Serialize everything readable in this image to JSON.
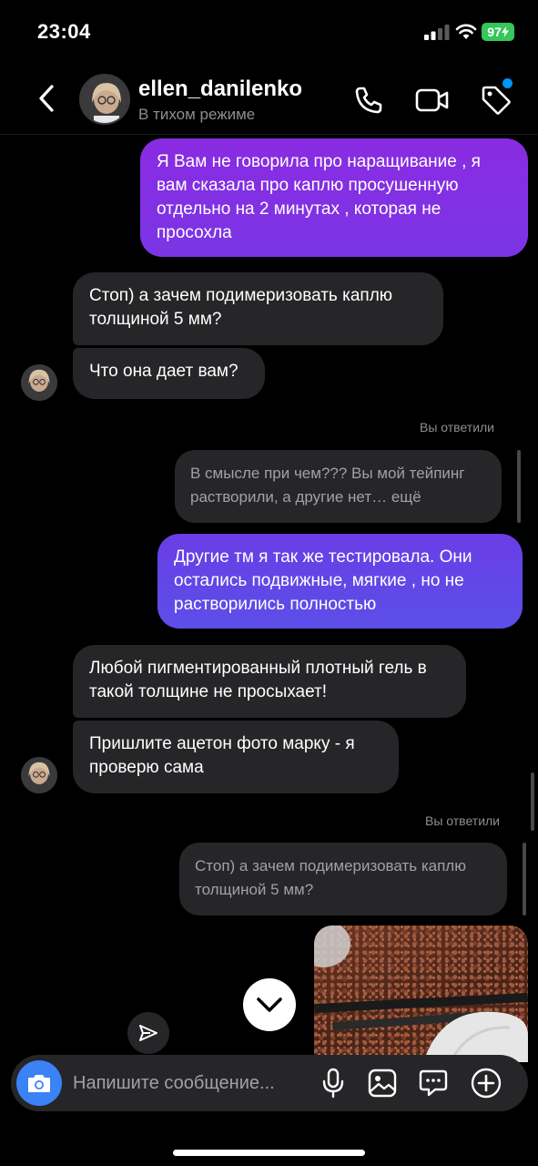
{
  "status": {
    "time": "23:04",
    "battery": "97"
  },
  "header": {
    "username": "ellen_danilenko",
    "subtitle": "В тихом режиме"
  },
  "colors": {
    "out_gradient_top": "#8a2be2",
    "out_gradient_bottom": "#5b4ee8",
    "accent_blue": "#3b82f6",
    "notify_blue": "#0095f6"
  },
  "messages": [
    {
      "dir": "out",
      "text": "Я Вам не говорила про наращивание , я вам сказала про каплю просушенную отдельно на 2 минутах , которая не просохла"
    },
    {
      "dir": "in",
      "text": "Стоп) а зачем подимеризовать каплю толщиной 5 мм?"
    },
    {
      "dir": "in",
      "text": "Что она дает вам?"
    },
    {
      "dir": "out",
      "reply_label": "Вы ответили",
      "reply_quote": "В смысле при чем??? Вы мой тейпинг растворили, а другие нет… ещё",
      "text": "Другие тм я так же тестировала. Они остались подвижные, мягкие  , но не растворились полностью"
    },
    {
      "dir": "in",
      "text": "Любой пигментированный плотный гель в такой толщине не просыхает!"
    },
    {
      "dir": "in",
      "text": "Пришлите ацетон фото марку - я проверю сама"
    },
    {
      "dir": "out",
      "reply_label": "Вы ответили",
      "reply_quote": "Стоп) а зачем подимеризовать каплю толщиной 5 мм?",
      "type": "photo"
    }
  ],
  "composer": {
    "placeholder": "Напишите сообщение..."
  },
  "icons": {
    "back": "chevron-left-icon",
    "call": "phone-icon",
    "video": "video-camera-icon",
    "tag": "tag-icon",
    "camera": "camera-icon",
    "mic": "microphone-icon",
    "gallery": "image-icon",
    "sticker": "chat-bubble-icon",
    "plus": "plus-circle-icon",
    "scroll": "chevron-down-icon",
    "send": "send-icon"
  }
}
